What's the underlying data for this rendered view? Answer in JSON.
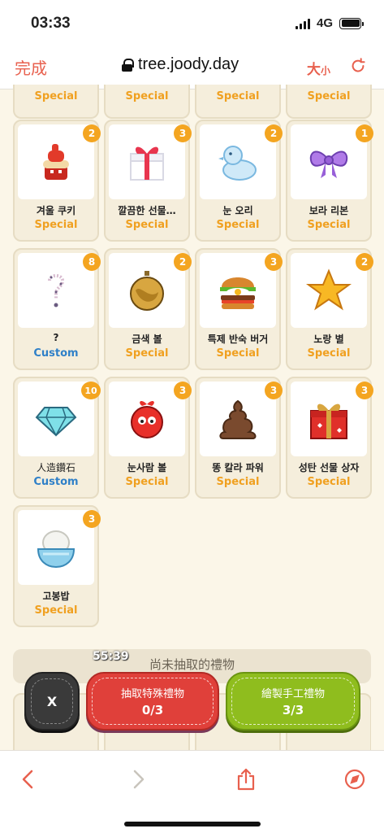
{
  "status_bar": {
    "time": "03:33",
    "network": "4G"
  },
  "browser": {
    "done_label": "完成",
    "url": "tree.joody.day",
    "text_size_large": "大",
    "text_size_small": "小"
  },
  "partial_row": [
    {
      "type": "Special"
    },
    {
      "type": "Special"
    },
    {
      "type": "Special"
    },
    {
      "type": "Special"
    }
  ],
  "gifts": [
    {
      "name": "겨울 쿠키",
      "type": "Special",
      "count": "2",
      "icon": "cookie-icon"
    },
    {
      "name": "깔끔한 선물…",
      "type": "Special",
      "count": "3",
      "icon": "gift-box-icon"
    },
    {
      "name": "눈 오리",
      "type": "Special",
      "count": "2",
      "icon": "snow-duck-icon"
    },
    {
      "name": "보라 리본",
      "type": "Special",
      "count": "1",
      "icon": "purple-ribbon-icon"
    },
    {
      "name": "?",
      "type": "Custom",
      "count": "8",
      "icon": "question-mark-icon"
    },
    {
      "name": "금색 볼",
      "type": "Special",
      "count": "2",
      "icon": "gold-ornament-icon"
    },
    {
      "name": "특제 반숙 버거",
      "type": "Special",
      "count": "3",
      "icon": "burger-icon"
    },
    {
      "name": "노랑 별",
      "type": "Special",
      "count": "2",
      "icon": "yellow-star-icon"
    },
    {
      "name": "人造鑽石",
      "type": "Custom",
      "count": "10",
      "icon": "diamond-icon"
    },
    {
      "name": "눈사람 볼",
      "type": "Special",
      "count": "3",
      "icon": "snowman-ornament-icon"
    },
    {
      "name": "똥 칼라 파워",
      "type": "Special",
      "count": "3",
      "icon": "poop-icon"
    },
    {
      "name": "성탄 선물 상자",
      "type": "Special",
      "count": "3",
      "icon": "christmas-gift-icon"
    },
    {
      "name": "고봉밥",
      "type": "Special",
      "count": "3",
      "icon": "rice-bowl-icon"
    }
  ],
  "summary": {
    "text": "尚未抽取的禮物",
    "timer": "55:39"
  },
  "actions": {
    "close_label": "X",
    "draw": {
      "label": "抽取特殊禮物",
      "count": "0/3"
    },
    "make": {
      "label": "繪製手工禮物",
      "count": "3/3"
    }
  },
  "colors": {
    "special": "#f0a020",
    "custom": "#2f80c8",
    "badge": "#f4a520",
    "accent": "#e8604e"
  }
}
